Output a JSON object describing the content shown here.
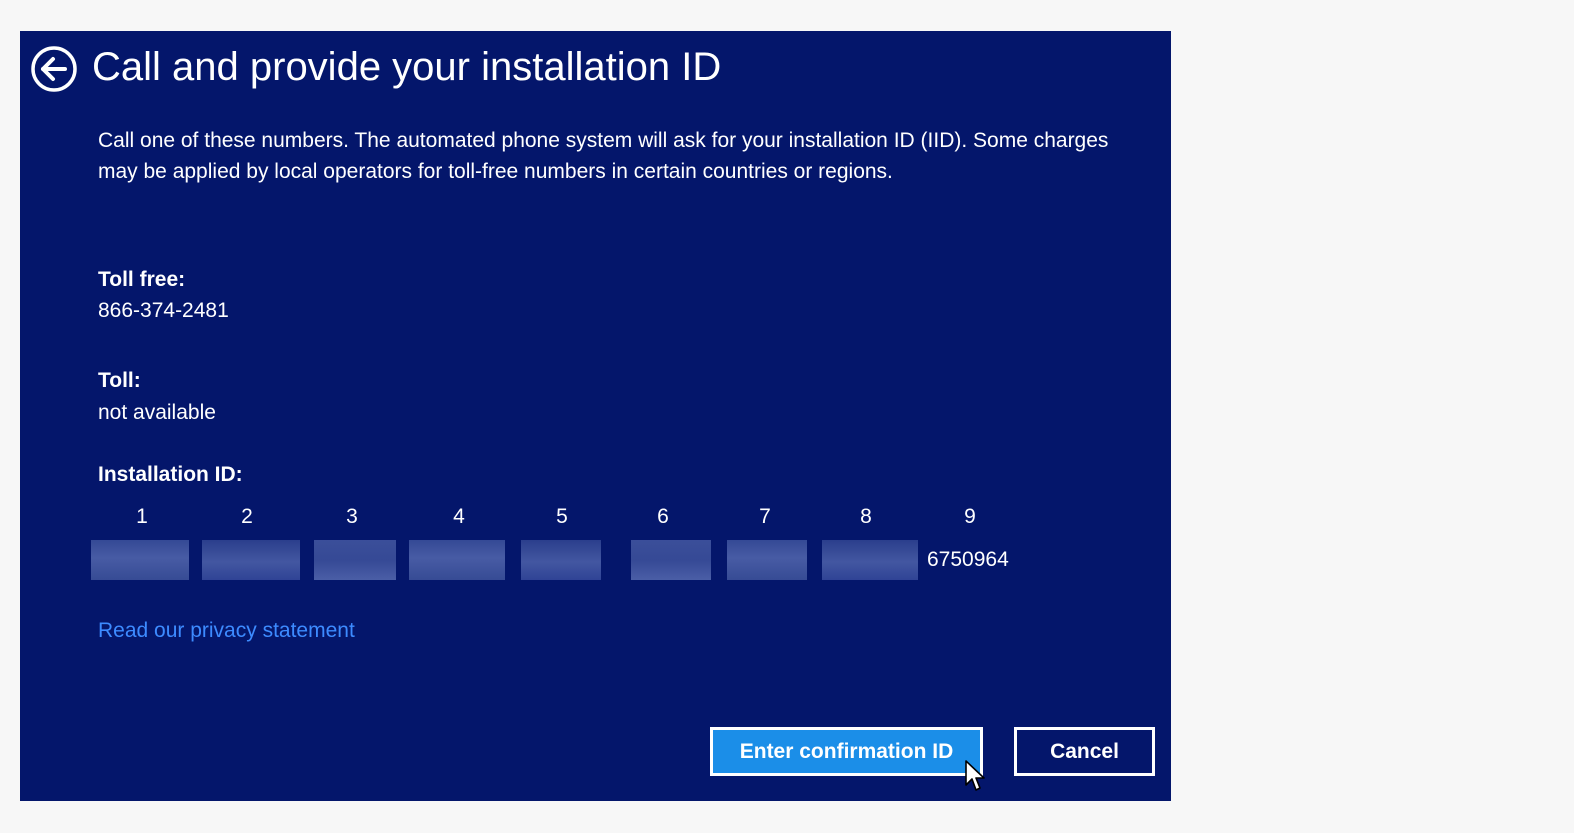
{
  "dialog": {
    "title": "Call and provide your installation ID",
    "description": "Call one of these numbers. The automated phone system will ask for your installation ID (IID). Some charges may be applied by local operators for toll-free numbers in certain countries or regions.",
    "toll_free_label": "Toll free:",
    "toll_free_value": "866-374-2481",
    "toll_label": "Toll:",
    "toll_value": "not available",
    "installation_id_label": "Installation ID:",
    "installation_id_columns": [
      "1",
      "2",
      "3",
      "4",
      "5",
      "6",
      "7",
      "8",
      "9"
    ],
    "installation_id_visible_block": "6750964",
    "privacy_link": "Read our privacy statement",
    "enter_button": "Enter confirmation ID",
    "cancel_button": "Cancel"
  },
  "icons": {
    "back": "back-arrow-circle-icon",
    "cursor": "mouse-pointer-icon"
  },
  "colors": {
    "dialog_background": "#04166b",
    "page_background": "#f7f7f7",
    "link": "#3d8bff",
    "primary_button": "#1b8ee8",
    "text": "#ffffff"
  }
}
